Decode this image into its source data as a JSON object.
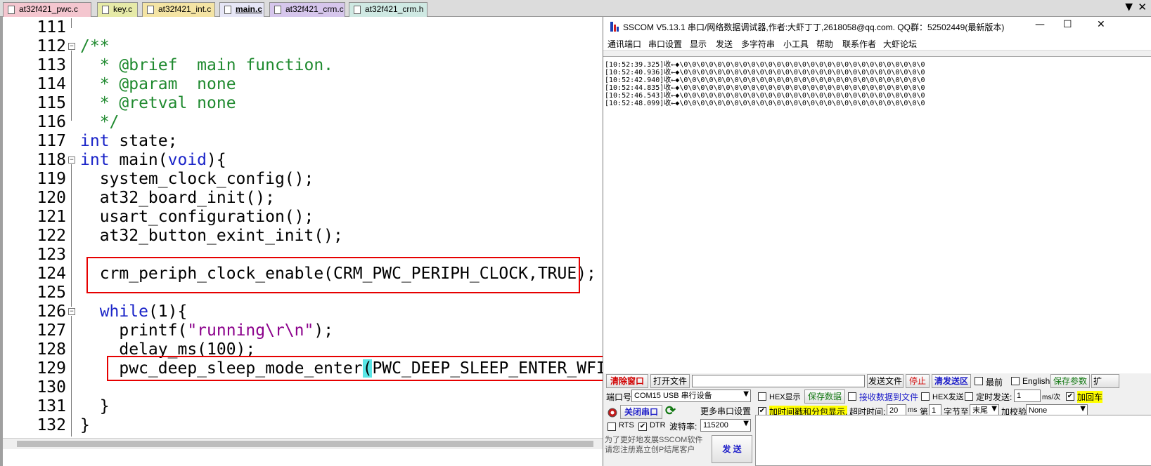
{
  "editor": {
    "tabs": [
      {
        "label": "at32f421_pwc.c",
        "color": "#f4c6cf",
        "active": false
      },
      {
        "label": "key.c",
        "color": "#e6eaa8",
        "active": false
      },
      {
        "label": "at32f421_int.c",
        "color": "#f4e4a4",
        "active": false
      },
      {
        "label": "main.c",
        "color": "#e6e6f6",
        "active": true
      },
      {
        "label": "at32f421_crm.c",
        "color": "#d6c6ec",
        "active": false
      },
      {
        "label": "at32f421_crm.h",
        "color": "#cfe9e3",
        "active": false
      }
    ],
    "menu_arrow": "▼",
    "close_glyph": "✕",
    "line_numbers": [
      "111",
      "112",
      "113",
      "114",
      "115",
      "116",
      "117",
      "118",
      "119",
      "120",
      "121",
      "122",
      "123",
      "124",
      "125",
      "126",
      "127",
      "128",
      "129",
      "130",
      "131",
      "132"
    ],
    "fold_minus": "−",
    "code": {
      "l112": "/**",
      "l113": "  * @brief  main function.",
      "l114": "  * @param  none",
      "l115": "  * @retval none",
      "l116": "  */",
      "l117_kw": "int",
      "l117_rest": " state;",
      "l118_kw1": "int",
      "l118_mid": " main(",
      "l118_kw2": "void",
      "l118_end": "){",
      "l119": "  system_clock_config();",
      "l120": "  at32_board_init();",
      "l121": "  usart_configuration();",
      "l122": "  at32_button_exint_init();",
      "l124": "  crm_periph_clock_enable(CRM_PWC_PERIPH_CLOCK,TRUE);",
      "l126_kw": "  while",
      "l126_rest": "(1){",
      "l127_a": "    printf(",
      "l127_str": "\"running\\r\\n\"",
      "l127_b": ");",
      "l128": "    delay_ms(100);",
      "l129_a": "    pwc_deep_sleep_mode_enter",
      "l129_p1": "(",
      "l129_b": "PWC_DEEP_SLEEP_ENTER_WFI",
      "l129_p2": ")",
      "l129_c": ";",
      "l131": "  }",
      "l132": "}"
    }
  },
  "sscom": {
    "title": "SSCOM V5.13.1 串口/网络数据调试器,作者:大虾丁丁,2618058@qq.com. QQ群：52502449(最新版本)",
    "win_min": "—",
    "win_max": "☐",
    "win_close": "✕",
    "menu": [
      "通讯端口",
      "串口设置",
      "显示",
      "发送",
      "多字符串",
      "小工具",
      "帮助",
      "联系作者",
      "大虾论坛"
    ],
    "rx_lines": [
      "[10:52:39.325]收←◆\\0\\0\\0\\0\\0\\0\\0\\0\\0\\0\\0\\0\\0\\0\\0\\0\\0\\0\\0\\0\\0\\0\\0\\0\\0\\0\\0\\0\\0",
      "[10:52:40.936]收←◆\\0\\0\\0\\0\\0\\0\\0\\0\\0\\0\\0\\0\\0\\0\\0\\0\\0\\0\\0\\0\\0\\0\\0\\0\\0\\0\\0\\0\\0",
      "[10:52:42.940]收←◆\\0\\0\\0\\0\\0\\0\\0\\0\\0\\0\\0\\0\\0\\0\\0\\0\\0\\0\\0\\0\\0\\0\\0\\0\\0\\0\\0\\0\\0",
      "[10:52:44.835]收←◆\\0\\0\\0\\0\\0\\0\\0\\0\\0\\0\\0\\0\\0\\0\\0\\0\\0\\0\\0\\0\\0\\0\\0\\0\\0\\0\\0\\0\\0",
      "[10:52:46.543]收←◆\\0\\0\\0\\0\\0\\0\\0\\0\\0\\0\\0\\0\\0\\0\\0\\0\\0\\0\\0\\0\\0\\0\\0\\0\\0\\0\\0\\0\\0",
      "[10:52:48.099]收←◆\\0\\0\\0\\0\\0\\0\\0\\0\\0\\0\\0\\0\\0\\0\\0\\0\\0\\0\\0\\0\\0\\0\\0\\0\\0\\0\\0\\0\\0"
    ],
    "row1": {
      "clear_window": "清除窗口",
      "open_file": "打开文件",
      "file_path": "",
      "send_file": "发送文件",
      "stop": "停止",
      "clear_send": "清发送区",
      "top_most": "最前",
      "english": "English",
      "save_params": "保存参数",
      "expand": "扩"
    },
    "row2": {
      "port_label": "端口号",
      "port_value": "COM15 USB 串行设备",
      "hex_display": "HEX显示",
      "save_data": "保存数据",
      "recv_to_file": "接收数据到文件",
      "hex_send": "HEX发送",
      "timed_send": "定时发送:",
      "interval": "1",
      "interval_unit": "ms/次",
      "add_crlf": "加回车"
    },
    "row3": {
      "close_port": "关闭串口",
      "refresh_glyph": "⟳",
      "more_settings": "更多串口设置",
      "timestamp_split": "加时间戳和分包显示.",
      "timeout_label": "超时时间:",
      "timeout_value": "20",
      "timeout_unit": "ms",
      "byte_prefix": "第",
      "byte_index": "1",
      "byte_label": "字节",
      "to_label": "至",
      "end_value": "末尾",
      "checksum_label": "加校验",
      "checksum_value": "None"
    },
    "row4": {
      "rts": "RTS",
      "dtr": "DTR",
      "baud_label": "波特率:",
      "baud_value": "115200"
    },
    "footer_note_1": "为了更好地发展SSCOM软件",
    "footer_note_2": "请您注册嘉立创P结尾客户",
    "send_button": "发 送",
    "check_mark": "✔",
    "dropdown_glyph": "▼"
  }
}
